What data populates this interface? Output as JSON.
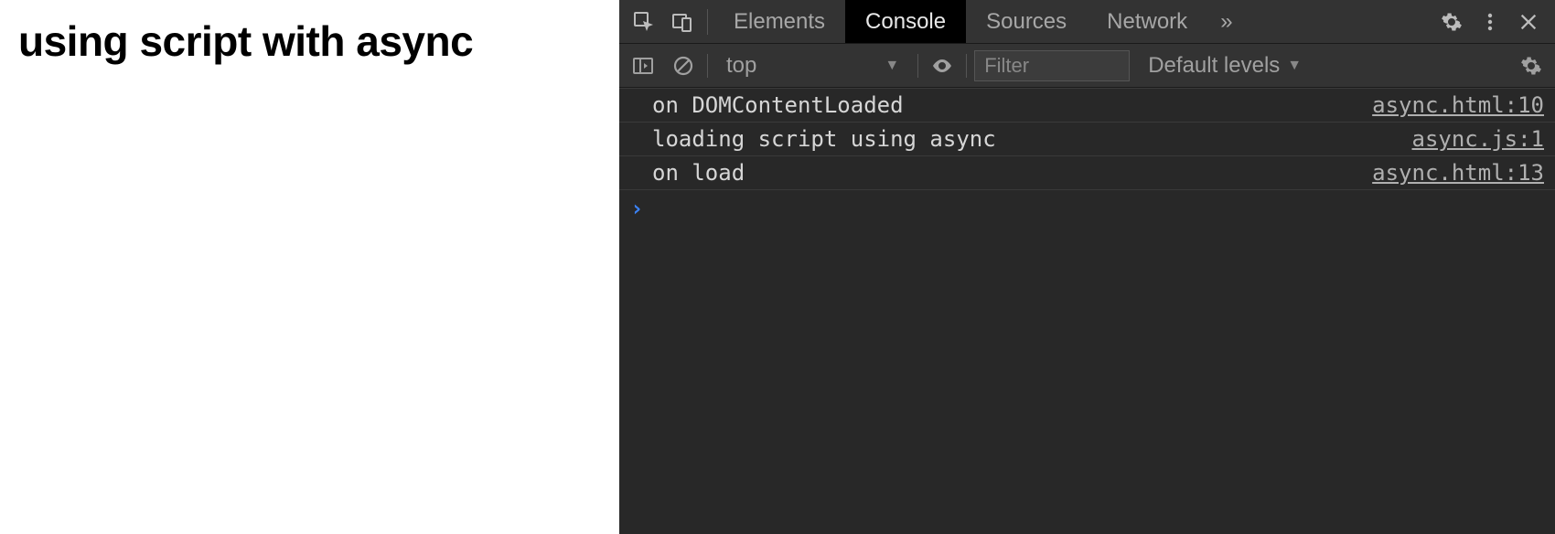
{
  "page": {
    "heading": "using script with async"
  },
  "devtools": {
    "tabs": {
      "items": [
        "Elements",
        "Console",
        "Sources",
        "Network"
      ],
      "active_index": 1,
      "overflow_glyph": "»"
    },
    "toolbar": {
      "context_label": "top",
      "filter_placeholder": "Filter",
      "levels_label": "Default levels"
    },
    "console": {
      "logs": [
        {
          "message": "on DOMContentLoaded",
          "source": "async.html:10"
        },
        {
          "message": "loading script using async",
          "source": "async.js:1"
        },
        {
          "message": "on load",
          "source": "async.html:13"
        }
      ],
      "prompt_glyph": "›"
    }
  }
}
